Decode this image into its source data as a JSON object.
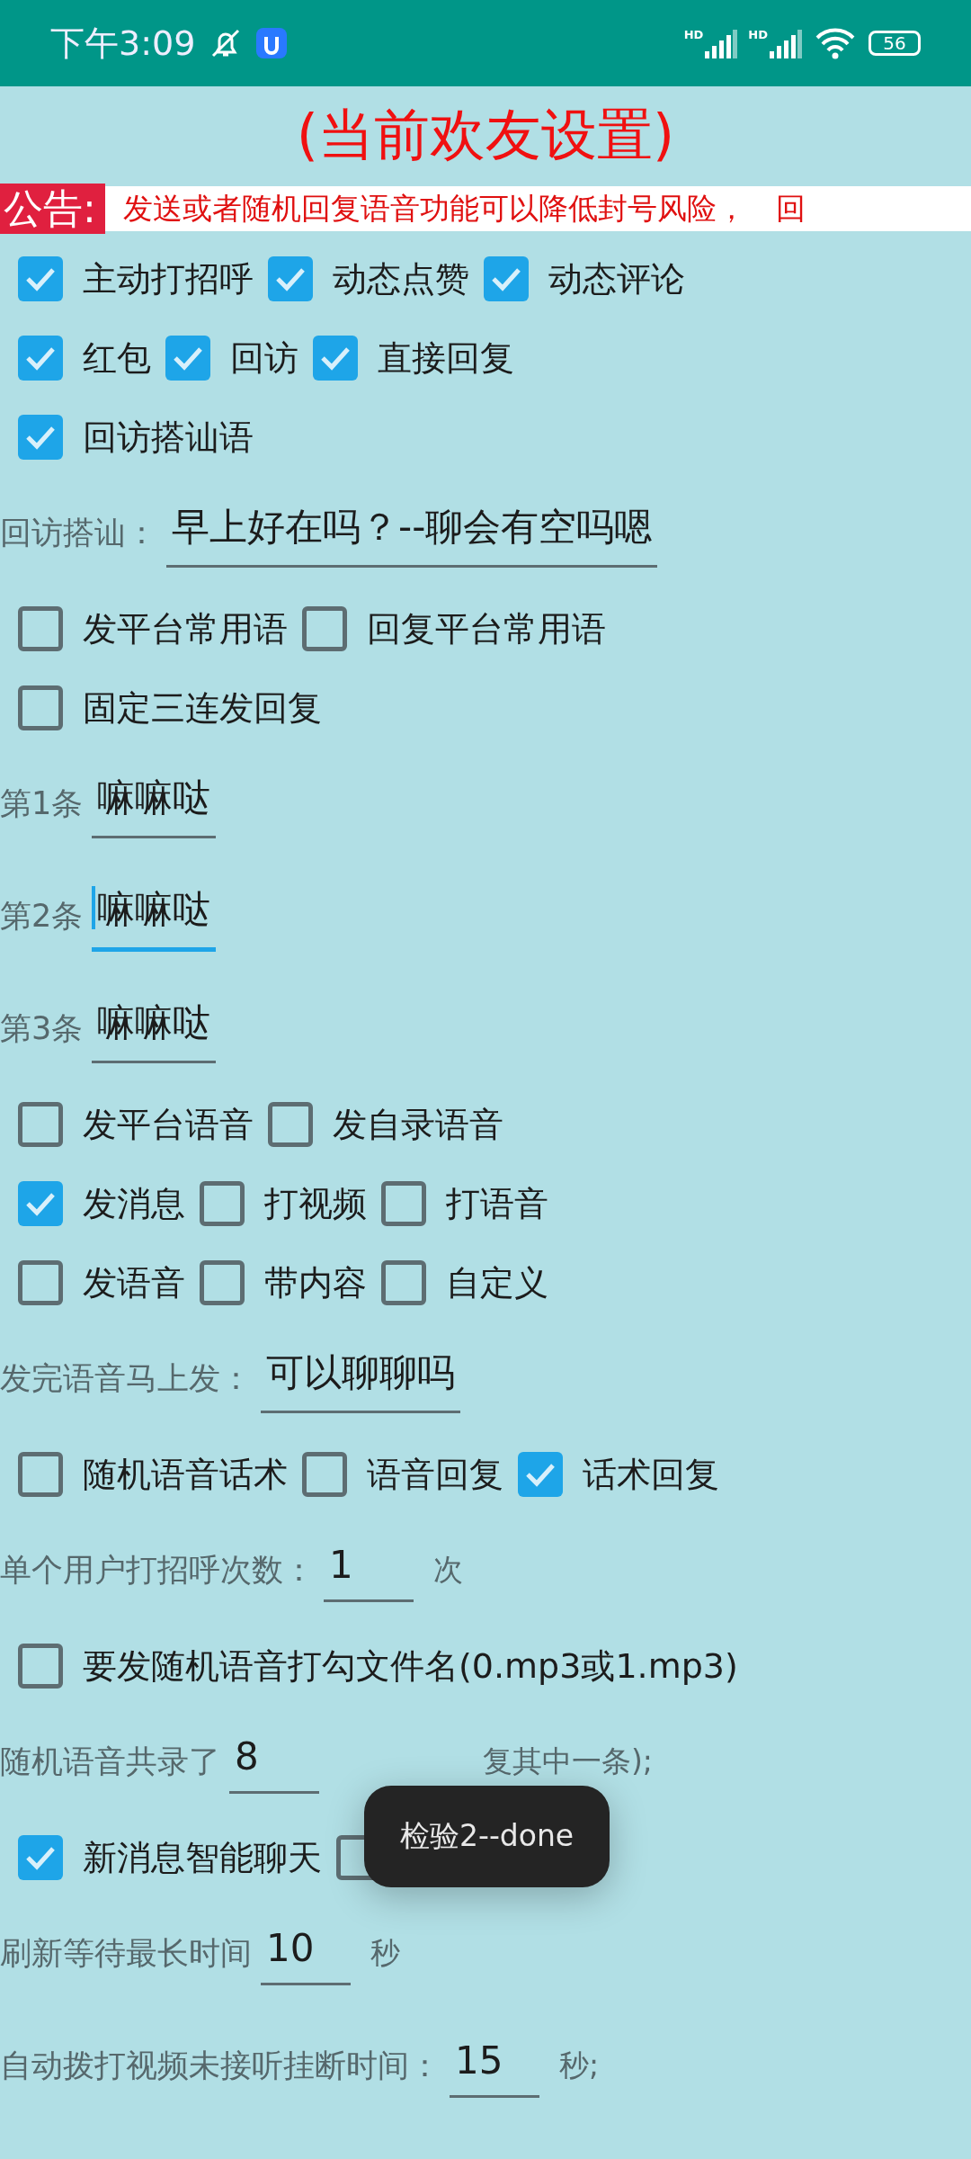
{
  "status_bar": {
    "time": "下午3:09",
    "signal_labels": [
      "HD",
      "HD"
    ],
    "battery": "56"
  },
  "title": "(当前欢友设置)",
  "notice": {
    "label": "公告:",
    "text": "发送或者随机回复语音功能可以降低封号风险，　回"
  },
  "items": [
    {
      "kind": "checks",
      "boxes": [
        {
          "label": "主动打招呼",
          "checked": true
        },
        {
          "label": "动态点赞",
          "checked": true
        },
        {
          "label": "动态评论",
          "checked": true
        }
      ]
    },
    {
      "kind": "checks",
      "boxes": [
        {
          "label": "红包",
          "checked": true
        },
        {
          "label": "回访",
          "checked": true
        },
        {
          "label": "直接回复",
          "checked": true
        }
      ]
    },
    {
      "kind": "checks",
      "boxes": [
        {
          "label": "回访搭讪语",
          "checked": true
        }
      ]
    },
    {
      "kind": "field",
      "label": "回访搭讪：",
      "value": "早上好在吗？--聊会有空吗嗯",
      "focused": false
    },
    {
      "kind": "checks",
      "boxes": [
        {
          "label": "发平台常用语",
          "checked": false
        },
        {
          "label": "回复平台常用语",
          "checked": false
        }
      ]
    },
    {
      "kind": "checks",
      "boxes": [
        {
          "label": "固定三连发回复",
          "checked": false
        }
      ]
    },
    {
      "kind": "field",
      "label": "第1条",
      "value": "嘛嘛哒",
      "focused": false
    },
    {
      "kind": "field",
      "label": "第2条",
      "value": "嘛嘛哒",
      "focused": true
    },
    {
      "kind": "field",
      "label": "第3条",
      "value": "嘛嘛哒",
      "focused": false
    },
    {
      "kind": "checks",
      "boxes": [
        {
          "label": "发平台语音",
          "checked": false
        },
        {
          "label": "发自录语音",
          "checked": false
        }
      ]
    },
    {
      "kind": "checks",
      "boxes": [
        {
          "label": "发消息",
          "checked": true
        },
        {
          "label": "打视频",
          "checked": false
        },
        {
          "label": "打语音",
          "checked": false
        }
      ]
    },
    {
      "kind": "checks",
      "boxes": [
        {
          "label": "发语音",
          "checked": false
        },
        {
          "label": "带内容",
          "checked": false
        },
        {
          "label": "自定义",
          "checked": false
        }
      ]
    },
    {
      "kind": "field",
      "label": "发完语音马上发：",
      "value": "可以聊聊吗",
      "focused": false
    },
    {
      "kind": "checks",
      "boxes": [
        {
          "label": "随机语音话术",
          "checked": false
        },
        {
          "label": "语音回复",
          "checked": false
        },
        {
          "label": "话术回复",
          "checked": true
        }
      ]
    },
    {
      "kind": "field",
      "label": "单个用户打招呼次数：",
      "value": "1",
      "suffix": "次",
      "focused": false
    },
    {
      "kind": "checks",
      "boxes": [
        {
          "label": "要发随机语音打勾文件名(0.mp3或1.mp3)",
          "checked": false
        }
      ]
    },
    {
      "kind": "field",
      "label": "随机语音共录了",
      "value": "8",
      "suffix": "复其中一条);",
      "focused": false
    },
    {
      "kind": "checks",
      "boxes": [
        {
          "label": "新消息智能聊天",
          "checked": true
        },
        {
          "checked": false
        }
      ]
    },
    {
      "kind": "field",
      "label": "刷新等待最长时间",
      "value": "10",
      "suffix": "秒",
      "focused": false
    },
    {
      "kind": "field",
      "label": "自动拨打视频未接听挂断时间：",
      "value": "15",
      "suffix": "秒;",
      "focused": false
    }
  ],
  "toast": "检验2--done"
}
